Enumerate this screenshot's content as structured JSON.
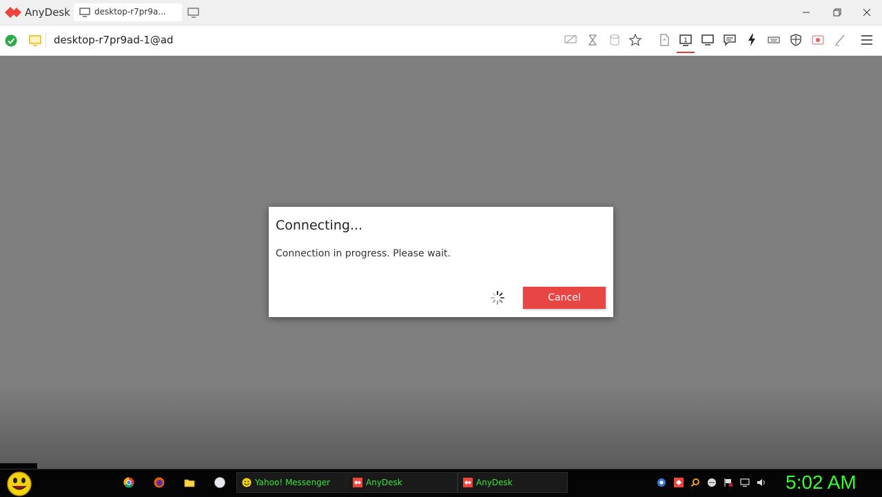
{
  "titlebar": {
    "app_name": "AnyDesk",
    "tab_title": "desktop-r7pr9a...",
    "logo_icon": "anydesk-logo-icon",
    "new_tab_icon": "new-connection-icon",
    "window_controls": [
      "minimize-icon",
      "restore-icon",
      "close-icon"
    ]
  },
  "addressbar": {
    "address": "desktop-r7pr9ad-1@ad",
    "status_icon": "connected-check-icon",
    "toolbar_icons": [
      "display-off-icon",
      "hourglass-icon",
      "database-icon",
      "star-icon",
      "file-transfer-icon",
      "monitor-1-icon",
      "monitor-icon",
      "chat-icon",
      "lightning-icon",
      "keyboard-icon",
      "shield-icon",
      "record-icon",
      "pen-icon",
      "menu-icon"
    ],
    "active_toolbar_icon": "monitor-1-icon",
    "monitor_number": "1"
  },
  "dialog": {
    "title": "Connecting...",
    "message": "Connection in progress. Please wait.",
    "cancel_label": "Cancel",
    "accent_color": "#e84545"
  },
  "taskbar": {
    "quick_launch": [
      "chrome-icon",
      "firefox-icon",
      "folder-icon",
      "globe-icon"
    ],
    "tasks": [
      {
        "label": "Yahoo! Messenger",
        "icon": "yahoo-messenger-icon"
      },
      {
        "label": "AnyDesk",
        "icon": "anydesk-icon"
      },
      {
        "label": "AnyDesk",
        "icon": "anydesk-icon"
      }
    ],
    "tray_icons": [
      "network-icon",
      "anydesk-tray-icon",
      "search-tray-icon",
      "globe-tray-icon",
      "flag-icon",
      "display-tray-icon",
      "volume-icon"
    ],
    "clock": "5:02 AM",
    "clock_color": "#32ff32"
  }
}
